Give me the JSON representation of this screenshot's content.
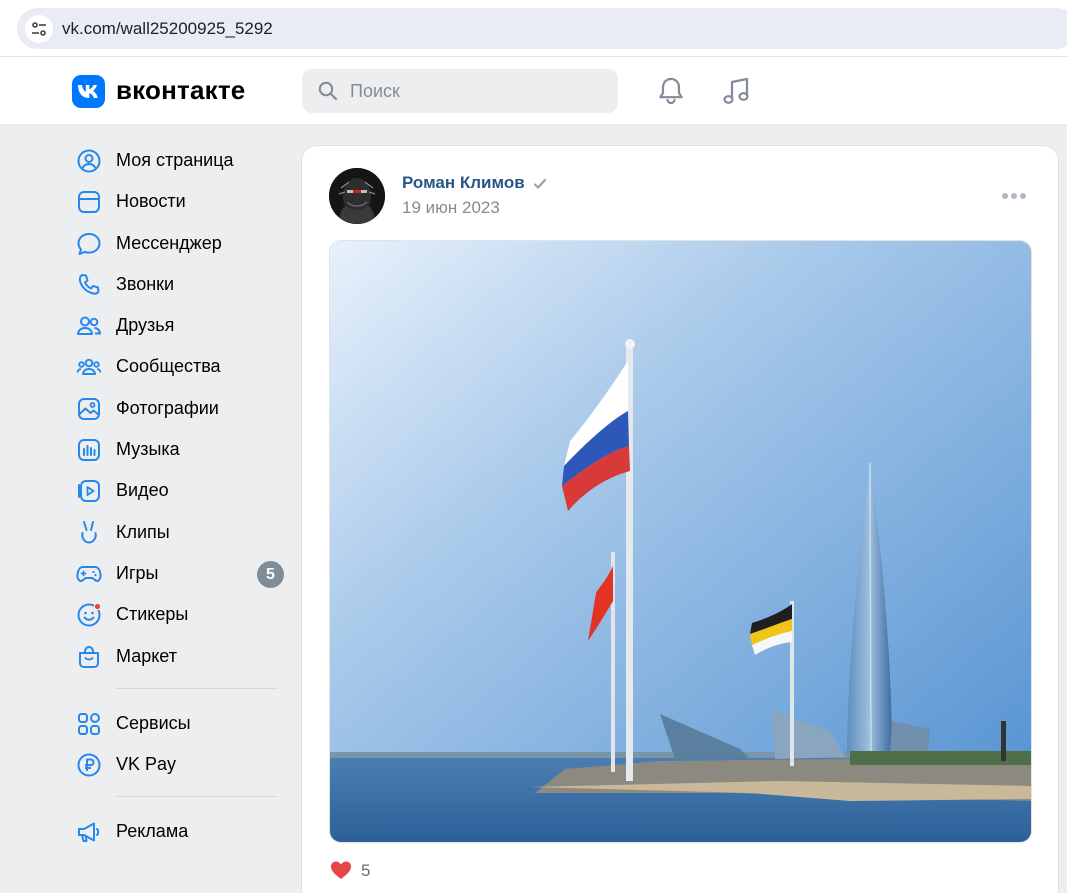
{
  "browser": {
    "url": "vk.com/wall25200925_5292",
    "site_info_icon": "tune-icon"
  },
  "header": {
    "logo_text": "вконтакте",
    "search_placeholder": "Поиск",
    "icons": [
      "bell-icon",
      "music-note-icon"
    ]
  },
  "sidebar": {
    "items": [
      {
        "label": "Моя страница",
        "icon": "user-circle-icon"
      },
      {
        "label": "Новости",
        "icon": "news-icon"
      },
      {
        "label": "Мессенджер",
        "icon": "chat-bubble-icon"
      },
      {
        "label": "Звонки",
        "icon": "phone-icon"
      },
      {
        "label": "Друзья",
        "icon": "friends-icon"
      },
      {
        "label": "Сообщества",
        "icon": "communities-icon"
      },
      {
        "label": "Фотографии",
        "icon": "photo-icon"
      },
      {
        "label": "Музыка",
        "icon": "music-icon"
      },
      {
        "label": "Видео",
        "icon": "video-icon"
      },
      {
        "label": "Клипы",
        "icon": "clips-icon"
      },
      {
        "label": "Игры",
        "icon": "gamepad-icon",
        "badge": "5"
      },
      {
        "label": "Стикеры",
        "icon": "sticker-icon",
        "dot": true
      },
      {
        "label": "Маркет",
        "icon": "market-bag-icon"
      }
    ],
    "items2": [
      {
        "label": "Сервисы",
        "icon": "services-grid-icon"
      },
      {
        "label": "VK Pay",
        "icon": "ruble-icon"
      }
    ],
    "items3": [
      {
        "label": "Реклама",
        "icon": "megaphone-icon"
      }
    ]
  },
  "post": {
    "author": "Роман Климов",
    "verified": true,
    "date": "19 июн 2023",
    "likes": "5"
  },
  "colors": {
    "accent": "#0077ff",
    "link": "#2a5885",
    "muted": "#818c99",
    "page_bg": "#edeef0",
    "like_red": "#e64646"
  }
}
